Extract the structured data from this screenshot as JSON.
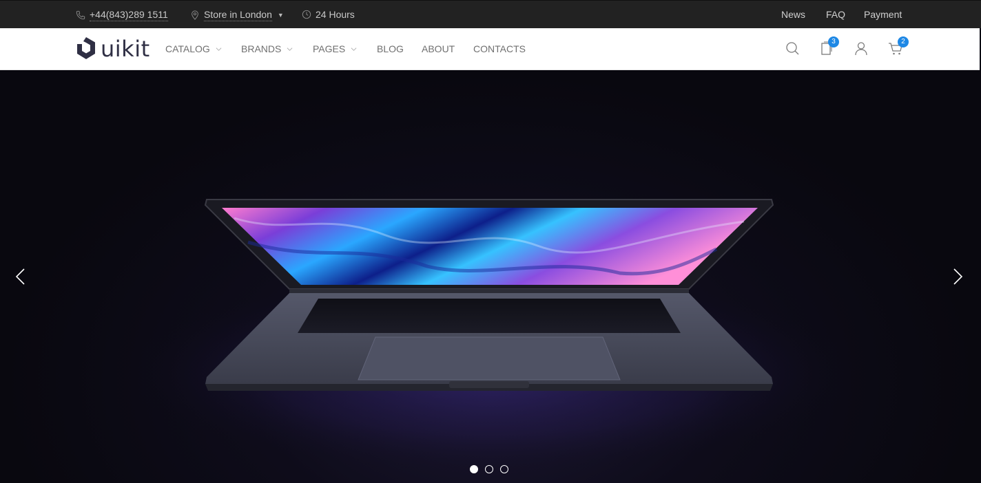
{
  "topbar": {
    "phone": "+44(843)289 1511",
    "store": "Store in London",
    "hours": "24 Hours",
    "links": [
      "News",
      "FAQ",
      "Payment"
    ],
    "icons": [
      "phone-icon",
      "location-icon",
      "clock-icon"
    ]
  },
  "nav": {
    "logo": "uikit",
    "menu": [
      {
        "label": "CATALOG",
        "dropdown": true
      },
      {
        "label": "BRANDS",
        "dropdown": true
      },
      {
        "label": "PAGES",
        "dropdown": true
      },
      {
        "label": "BLOG",
        "dropdown": false
      },
      {
        "label": "ABOUT",
        "dropdown": false
      },
      {
        "label": "CONTACTS",
        "dropdown": false
      }
    ],
    "compare_count": "3",
    "cart_count": "2",
    "icons": [
      "search-icon",
      "compare-icon",
      "user-icon",
      "cart-icon"
    ]
  },
  "hero": {
    "slides": 3,
    "active_slide": 1,
    "controls": [
      "chevron-left-icon",
      "chevron-right-icon"
    ]
  },
  "colors": {
    "topbar_bg": "#222222",
    "accent": "#1e88e5",
    "nav_text": "#6f6f6f"
  }
}
